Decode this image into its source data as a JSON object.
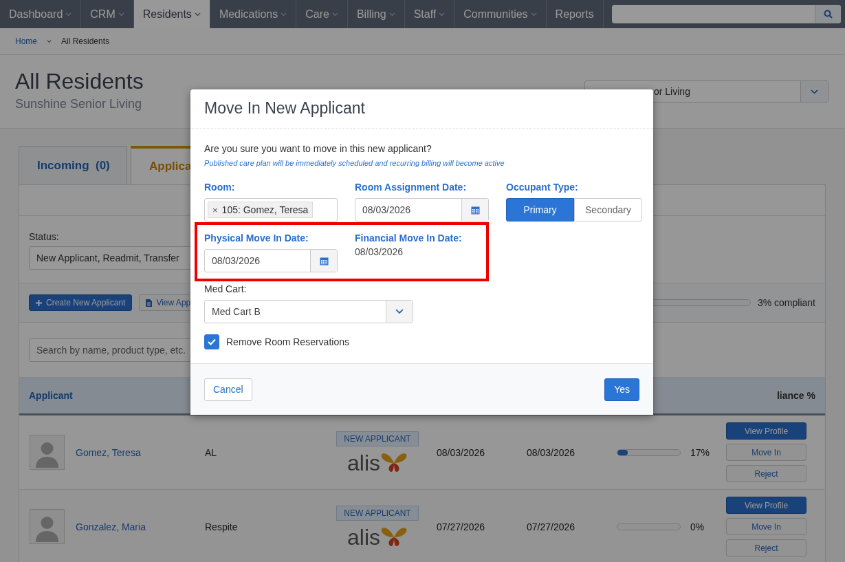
{
  "nav": {
    "items": [
      {
        "label": "Dashboard",
        "dropdown": true,
        "selected": false
      },
      {
        "label": "CRM",
        "dropdown": true,
        "selected": false
      },
      {
        "label": "Residents",
        "dropdown": true,
        "selected": true
      },
      {
        "label": "Medications",
        "dropdown": true,
        "selected": false
      },
      {
        "label": "Care",
        "dropdown": true,
        "selected": false
      },
      {
        "label": "Billing",
        "dropdown": true,
        "selected": false
      },
      {
        "label": "Staff",
        "dropdown": true,
        "selected": false
      },
      {
        "label": "Communities",
        "dropdown": true,
        "selected": false
      },
      {
        "label": "Reports",
        "dropdown": false,
        "selected": false
      }
    ]
  },
  "breadcrumb": [
    "Home",
    "All Residents"
  ],
  "header": {
    "title": "All Residents",
    "subtitle": "Sunshine Senior Living",
    "community": "or Living"
  },
  "tabs": [
    {
      "label": "Incoming  (0)",
      "selected": false
    },
    {
      "label": "Applica",
      "selected": true
    }
  ],
  "filters": {
    "status_label": "Status:",
    "status_value": "New Applicant, Readmit, Transfer"
  },
  "toolbar": {
    "create_button": "Create New Applicant",
    "view_button": "View App",
    "compliance": {
      "level": 0.03,
      "reading": "3% compliant"
    }
  },
  "search": {
    "placeholder": "Search by name, product type, etc."
  },
  "table": {
    "columns": [
      "Applicant",
      "liance %"
    ],
    "rows": [
      {
        "name": "Gomez, Teresa",
        "care": "AL",
        "badge": "NEW APPLICANT",
        "logo": "alis",
        "date_1": "08/03/2026",
        "date_2": "08/03/2026",
        "level": 0.17,
        "percent": "17%",
        "actions": [
          "View Profile",
          "Move In",
          "Reject"
        ]
      },
      {
        "name": "Gonzalez, Maria",
        "care": "Respite",
        "badge": "NEW APPLICANT",
        "logo": "alis",
        "date_1": "07/27/2026",
        "date_2": "07/27/2026",
        "level": 0,
        "percent": "0%",
        "actions": [
          "View Profile",
          "Move In",
          "Reject"
        ]
      }
    ]
  },
  "modal": {
    "title": "Move In New Applicant",
    "question": "Are you sure you want to move in this new applicant?",
    "note": "Published care plan will be immediately scheduled and recurring billing will become active",
    "room": {
      "label": "Room:",
      "remove": "×",
      "value": "105: Gomez, Teresa"
    },
    "room_assignment": {
      "label": "Room Assignment Date:",
      "value": "08/03/2026"
    },
    "occupant_type": {
      "label": "Occupant Type:",
      "options": [
        {
          "label": "Primary",
          "selected": true
        },
        {
          "label": "Secondary",
          "selected": false
        }
      ]
    },
    "physical_move_in": {
      "label": "Physical Move In Date:",
      "value": "08/03/2026"
    },
    "financial_move_in": {
      "label": "Financial Move In Date:",
      "value": "08/03/2026"
    },
    "highlighted": true,
    "med_cart": {
      "label": "Med Cart:",
      "value": "Med Cart B"
    },
    "remove_reservations": {
      "label": "Remove Room Reservations",
      "checked": true
    },
    "cancel": "Cancel",
    "confirm": "Yes"
  }
}
